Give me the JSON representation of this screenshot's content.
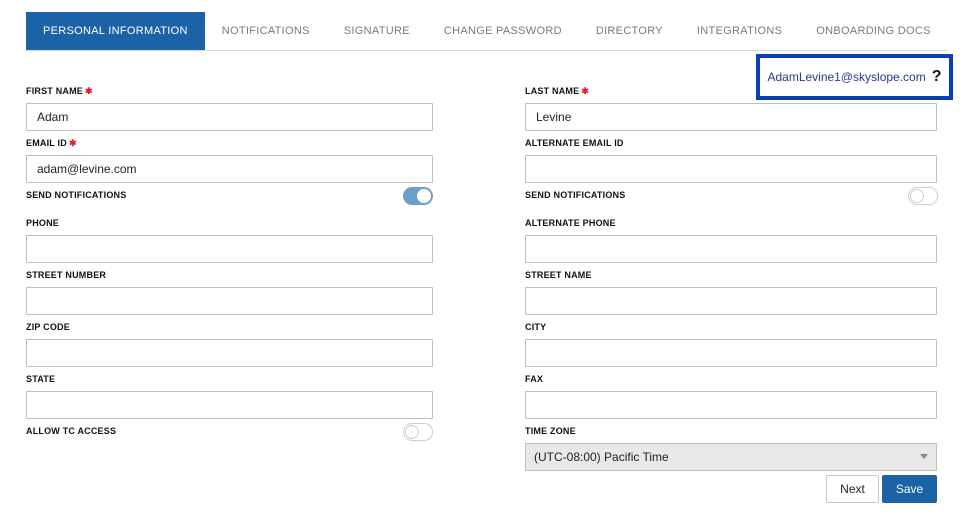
{
  "tabs": [
    {
      "label": "PERSONAL INFORMATION",
      "active": true
    },
    {
      "label": "NOTIFICATIONS"
    },
    {
      "label": "SIGNATURE"
    },
    {
      "label": "CHANGE PASSWORD"
    },
    {
      "label": "DIRECTORY"
    },
    {
      "label": "INTEGRATIONS"
    },
    {
      "label": "ONBOARDING DOCS"
    }
  ],
  "account": {
    "email": "AdamLevine1@skyslope.com",
    "help_glyph": "?"
  },
  "required_marker": "✱",
  "left": {
    "first_name": {
      "label": "FIRST NAME",
      "value": "Adam"
    },
    "email_id": {
      "label": "EMAIL ID",
      "value": "adam@levine.com"
    },
    "send_notifications": {
      "label": "SEND NOTIFICATIONS",
      "on": true
    },
    "phone": {
      "label": "PHONE",
      "value": ""
    },
    "street_number": {
      "label": "STREET NUMBER",
      "value": ""
    },
    "zip_code": {
      "label": "ZIP CODE",
      "value": ""
    },
    "state": {
      "label": "STATE",
      "value": ""
    },
    "allow_tc_access": {
      "label": "ALLOW TC ACCESS",
      "on": false
    }
  },
  "right": {
    "last_name": {
      "label": "LAST NAME",
      "value": "Levine"
    },
    "alternate_email_id": {
      "label": "ALTERNATE EMAIL ID",
      "value": ""
    },
    "send_notifications": {
      "label": "SEND NOTIFICATIONS",
      "on": false
    },
    "alternate_phone": {
      "label": "ALTERNATE PHONE",
      "value": ""
    },
    "street_name": {
      "label": "STREET NAME",
      "value": ""
    },
    "city": {
      "label": "CITY",
      "value": ""
    },
    "fax": {
      "label": "FAX",
      "value": ""
    },
    "time_zone": {
      "label": "TIME ZONE",
      "value": "(UTC-08:00) Pacific Time"
    }
  },
  "buttons": {
    "next": "Next",
    "save": "Save"
  }
}
